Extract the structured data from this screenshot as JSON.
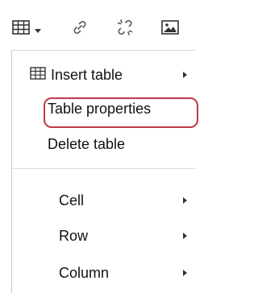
{
  "top_clip_text": "",
  "toolbar": {
    "buttons": [
      {
        "name": "table",
        "icon": "table-grid-icon",
        "has_dropdown": true
      },
      {
        "name": "link",
        "icon": "link-icon"
      },
      {
        "name": "unlink",
        "icon": "unlink-icon"
      },
      {
        "name": "image",
        "icon": "image-icon"
      }
    ]
  },
  "menu": {
    "items": [
      {
        "label": "Insert table",
        "icon": "table-grid-icon",
        "submenu": true
      },
      {
        "label": "Table properties",
        "highlighted": true
      },
      {
        "label": "Delete table"
      },
      {
        "label": "Cell",
        "submenu": true
      },
      {
        "label": "Row",
        "submenu": true
      },
      {
        "label": "Column",
        "submenu": true
      }
    ]
  },
  "colors": {
    "highlight_border": "#c23a4a",
    "text": "#111111",
    "divider": "#d6d6d6"
  }
}
